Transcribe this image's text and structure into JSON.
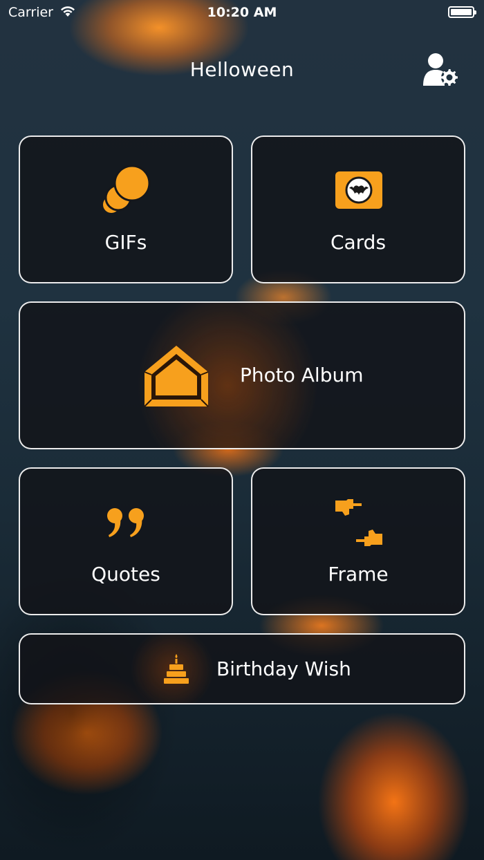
{
  "status_bar": {
    "carrier": "Carrier",
    "time": "10:20 AM"
  },
  "nav": {
    "title": "Helloween",
    "settings_icon": "user-settings-icon"
  },
  "tiles": [
    {
      "id": "gifs",
      "label": "GIFs",
      "icon": "coins-stack-icon"
    },
    {
      "id": "cards",
      "label": "Cards",
      "icon": "bat-card-icon"
    },
    {
      "id": "album",
      "label": "Photo Album",
      "icon": "house-frame-icon"
    },
    {
      "id": "quotes",
      "label": "Quotes",
      "icon": "quote-marks-icon"
    },
    {
      "id": "frame",
      "label": "Frame",
      "icon": "frame-hands-icon"
    },
    {
      "id": "birthday",
      "label": "Birthday Wish",
      "icon": "birthday-cake-icon"
    }
  ],
  "colors": {
    "accent": "#F7A01D",
    "tile_border": "#FFFFFF",
    "tile_background": "#121418"
  }
}
